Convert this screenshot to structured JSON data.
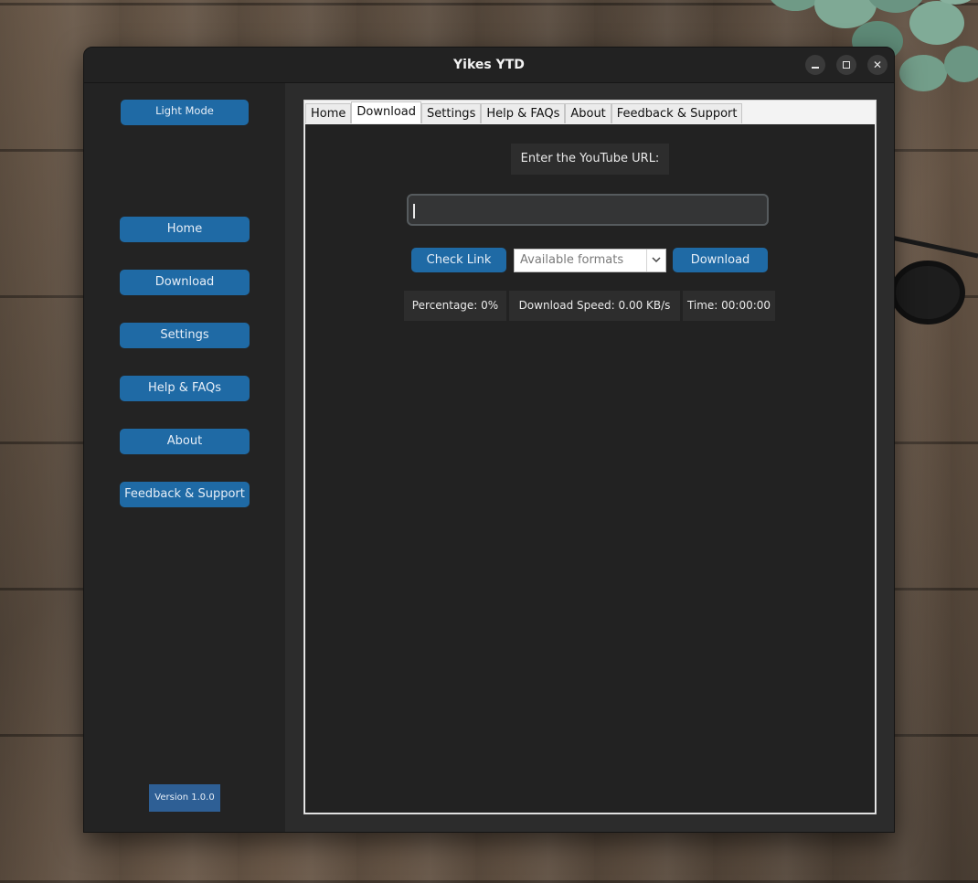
{
  "window": {
    "title": "Yikes YTD"
  },
  "sidebar": {
    "theme_toggle_label": "Light Mode",
    "items": [
      {
        "label": "Home"
      },
      {
        "label": "Download"
      },
      {
        "label": "Settings"
      },
      {
        "label": "Help & FAQs"
      },
      {
        "label": "About"
      },
      {
        "label": "Feedback & Support"
      }
    ],
    "version": "Version 1.0.0"
  },
  "tabs": [
    {
      "label": "Home",
      "active": false
    },
    {
      "label": "Download",
      "active": true
    },
    {
      "label": "Settings",
      "active": false
    },
    {
      "label": "Help & FAQs",
      "active": false
    },
    {
      "label": "About",
      "active": false
    },
    {
      "label": "Feedback & Support",
      "active": false
    }
  ],
  "download_panel": {
    "url_label": "Enter the YouTube URL:",
    "url_value": "",
    "check_link_label": "Check Link",
    "formats_selected": "Available formats",
    "download_label": "Download",
    "percentage": "Percentage: 0%",
    "speed": "Download Speed: 0.00 KB/s",
    "time": "Time: 00:00:00"
  },
  "colors": {
    "accent": "#1f6aa5",
    "window_bg": "#272727",
    "panel_bg": "#222222",
    "version_bg": "#2e5f95"
  },
  "icons": {
    "minimize": "minimize-icon",
    "maximize": "maximize-icon",
    "close": "close-icon",
    "dropdown": "chevron-down-icon"
  }
}
